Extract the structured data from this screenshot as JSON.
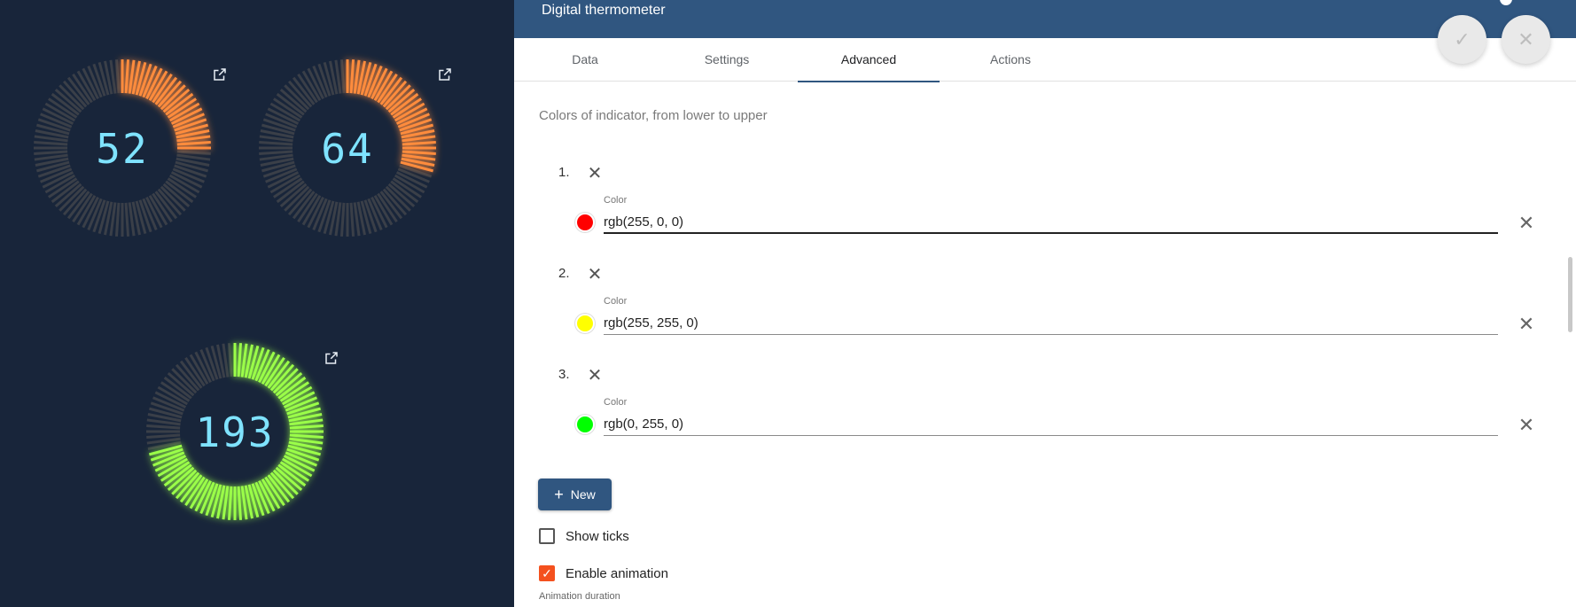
{
  "dashboard": {
    "gauges": [
      {
        "value": "52",
        "fraction": 0.26,
        "color": "#ff8c3c",
        "glow": "#ff9a4d"
      },
      {
        "value": "64",
        "fraction": 0.3,
        "color": "#ff8c3c",
        "glow": "#ff9a4d"
      },
      {
        "value": "193",
        "fraction": 0.72,
        "color": "#9bff4a",
        "glow": "#7dff2a"
      }
    ]
  },
  "panel": {
    "title": "Digital thermometer",
    "tabs": [
      {
        "label": "Data"
      },
      {
        "label": "Settings"
      },
      {
        "label": "Advanced"
      },
      {
        "label": "Actions"
      }
    ],
    "active_tab": "Advanced",
    "section_label": "Colors of indicator, from lower to upper",
    "colors": [
      {
        "num": "1.",
        "field_label": "Color",
        "value": "rgb(255, 0, 0)",
        "swatch": "#ff0000"
      },
      {
        "num": "2.",
        "field_label": "Color",
        "value": "rgb(255, 255, 0)",
        "swatch": "#ffff00"
      },
      {
        "num": "3.",
        "field_label": "Color",
        "value": "rgb(0, 255, 0)",
        "swatch": "#00ff00"
      }
    ],
    "new_button": "New",
    "show_ticks": {
      "label": "Show ticks",
      "checked": false
    },
    "enable_animation": {
      "label": "Enable animation",
      "checked": true
    },
    "animation_duration_label": "Animation duration"
  }
}
